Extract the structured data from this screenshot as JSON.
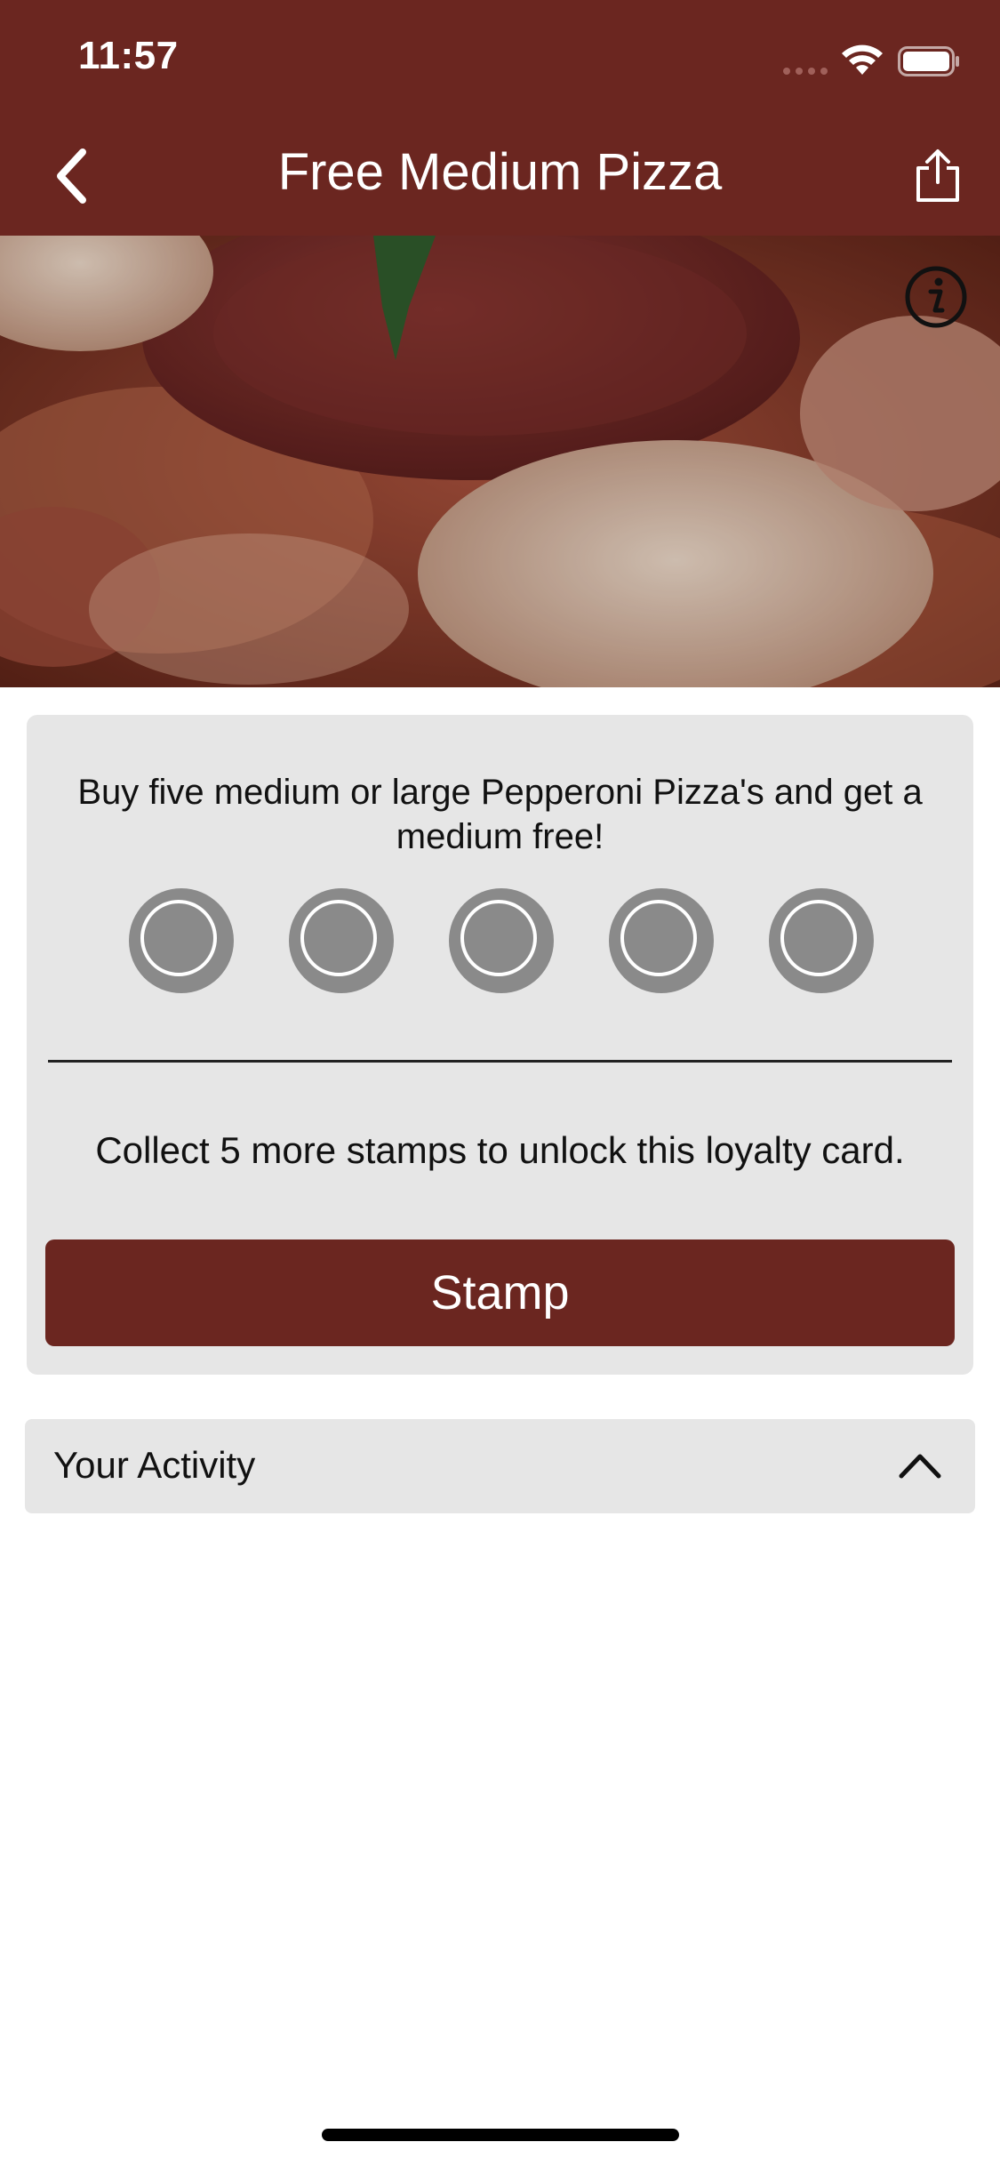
{
  "status_bar": {
    "time": "11:57"
  },
  "nav": {
    "title": "Free Medium Pizza"
  },
  "card": {
    "description": "Buy five medium or large Pepperoni Pizza's and get a medium free!",
    "stamps_total": 5,
    "stamps_collected": 0,
    "collect_message": "Collect 5 more stamps to unlock this loyalty card.",
    "stamp_button_label": "Stamp"
  },
  "activity": {
    "label": "Your Activity"
  },
  "colors": {
    "brand": "#6b2620",
    "card_bg": "#e6e6e6",
    "stamp_empty": "#8a8a8a"
  },
  "icons": [
    "chevron-left-icon",
    "share-icon",
    "info-icon",
    "wifi-icon",
    "battery-icon",
    "chevron-up-icon"
  ]
}
